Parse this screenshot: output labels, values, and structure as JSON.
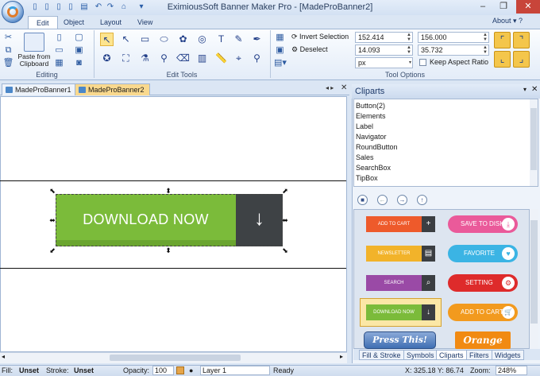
{
  "title": "EximiousSoft Banner Maker Pro - [MadeProBanner2]",
  "window": {
    "about": "About",
    "minimize": "–",
    "restore": "❐",
    "close": "✕"
  },
  "ribbon_tabs": [
    "Edit",
    "Object",
    "Layout",
    "View"
  ],
  "editing": {
    "paste_label_1": "Paste from",
    "paste_label_2": "Clipboard",
    "group_label": "Editing"
  },
  "edit_tools": {
    "group_label": "Edit Tools"
  },
  "tool_options": {
    "invert_selection": "Invert Selection",
    "deselect": "Deselect",
    "x": "152.414",
    "y": "14.093",
    "width": "156.000",
    "height": "35.732",
    "unit": "px",
    "keep_aspect": "Keep Aspect Ratio",
    "group_label": "Tool Options"
  },
  "doc_tabs": [
    "MadeProBanner1",
    "MadeProBanner2"
  ],
  "banner": {
    "label": "DOWNLOAD NOW",
    "arrow": "↓"
  },
  "cliparts_panel": {
    "title": "Cliparts",
    "items": [
      "Button(2)",
      "Elements",
      "Label",
      "Navigator",
      "RoundButton",
      "Sales",
      "SearchBox",
      "TipBox"
    ],
    "gallery_left": [
      {
        "label": "ADD TO CART",
        "icon": "+",
        "color": "#ee5a2b"
      },
      {
        "label": "NEWSLETTER",
        "icon": "▤",
        "color": "#f2b32a"
      },
      {
        "label": "SEARCH",
        "icon": "⌕",
        "color": "#9a4aa6"
      },
      {
        "label": "DOWNLOAD NOW",
        "icon": "↓",
        "color": "#7bbb3a"
      }
    ],
    "gallery_right": [
      {
        "label": "SAVE TO DISK",
        "icon": "⤓",
        "color": "#ea5a9a"
      },
      {
        "label": "FAVORITE",
        "icon": "♥",
        "color": "#3bb4e4"
      },
      {
        "label": "SETTING",
        "icon": "⚙",
        "color": "#de2b2b"
      },
      {
        "label": "ADD TO CART",
        "icon": "🛒",
        "color": "#f29a1e"
      }
    ],
    "press_this": "Press This!",
    "orange": "Orange"
  },
  "panel_tabs": [
    "Fill & Stroke",
    "Symbols",
    "Cliparts",
    "Filters",
    "Widgets"
  ],
  "status": {
    "fill_label": "Fill:",
    "fill_value": "Unset",
    "stroke_label": "Stroke:",
    "stroke_value": "Unset",
    "opacity_label": "Opacity:",
    "opacity_value": "100",
    "layer": "Layer 1",
    "ready": "Ready",
    "coords": "X: 325.18 Y: 86.74",
    "zoom_label": "Zoom:",
    "zoom_value": "248%"
  }
}
